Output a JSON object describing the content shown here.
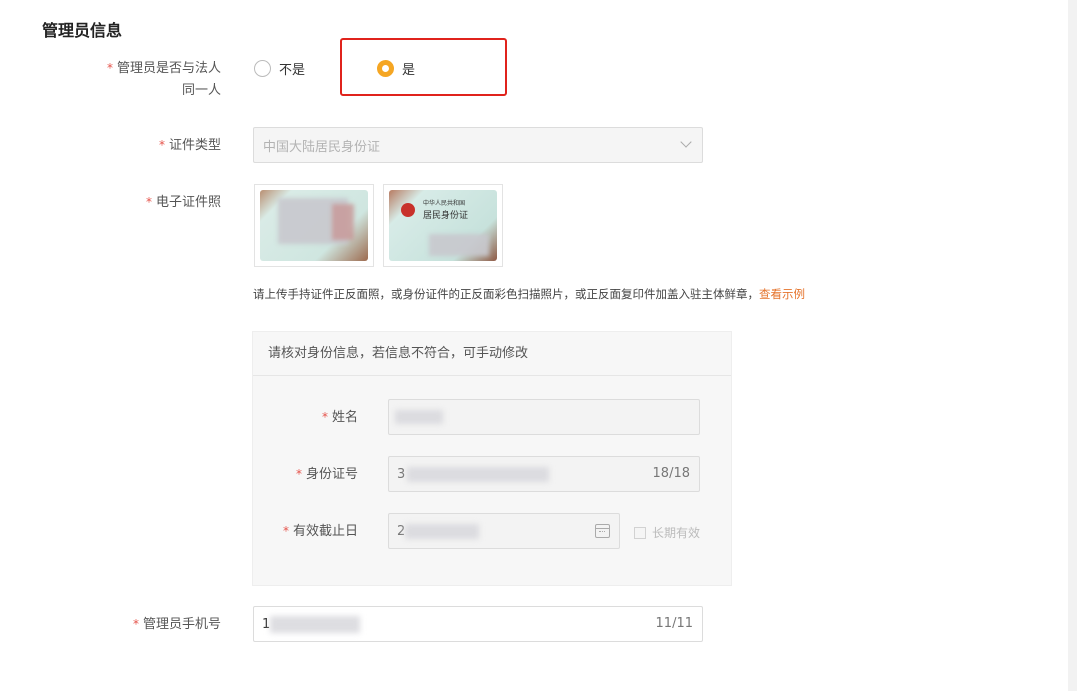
{
  "section": {
    "title": "管理员信息"
  },
  "same_person": {
    "label_line1": "管理员是否与法人",
    "label_line2": "同一人",
    "option_no": "不是",
    "option_yes": "是",
    "selected": "是"
  },
  "id_type": {
    "label": "证件类型",
    "value": "中国大陆居民身份证"
  },
  "id_photo": {
    "label": "电子证件照",
    "back_card_line1": "中华人民共和国",
    "back_card_line2": "居民身份证",
    "hint_text": "请上传手持证件正反面照，或身份证件的正反面彩色扫描照片，或正反面复印件加盖入驻主体鲜章，",
    "hint_link": "查看示例"
  },
  "verify": {
    "heading": "请核对身份信息，若信息不符合，可手动修改",
    "name_label": "姓名",
    "id_number_label": "身份证号",
    "id_number_prefix": "3",
    "id_number_count": "18/18",
    "expiry_label": "有效截止日",
    "expiry_prefix": "2",
    "long_term_label": "长期有效"
  },
  "phone": {
    "label": "管理员手机号",
    "prefix": "1",
    "count": "11/11"
  },
  "colors": {
    "accent": "#f5a623",
    "required": "#e5534b",
    "link": "#e5742d",
    "highlight": "#e0231c"
  }
}
